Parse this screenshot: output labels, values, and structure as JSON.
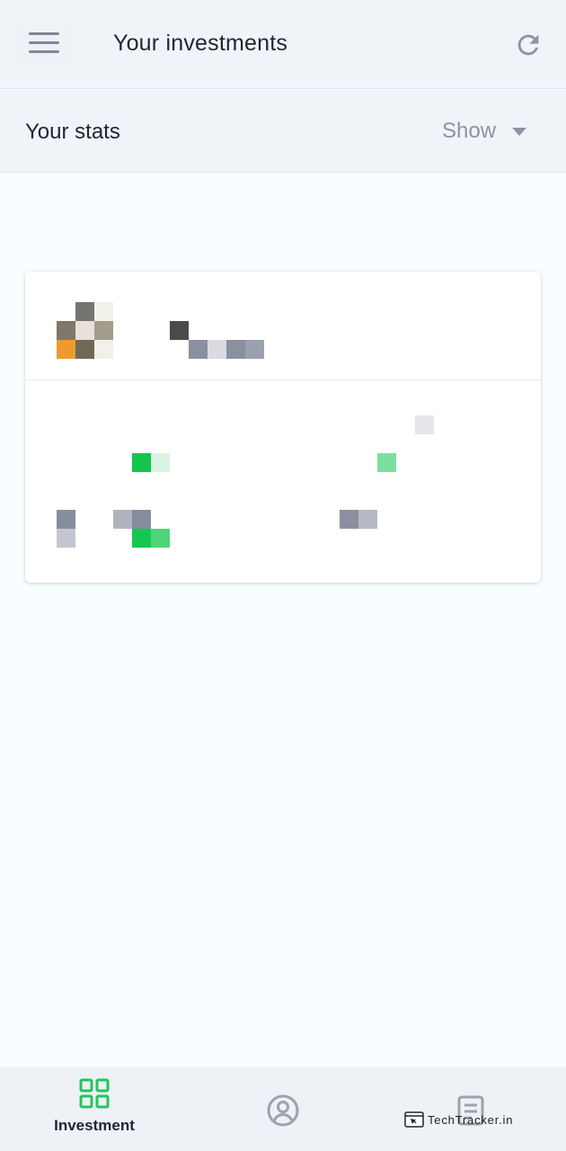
{
  "appbar": {
    "title": "Your investments",
    "menu_icon": "hamburger-menu-icon",
    "refresh_icon": "refresh-icon"
  },
  "stats": {
    "title": "Your stats",
    "dropdown_value": "Show"
  },
  "card": {
    "logo_alt": "pixelated-logo",
    "redacted": true
  },
  "bottom_nav": {
    "items": [
      {
        "label": "Investment",
        "icon": "grid-icon",
        "active": true
      },
      {
        "label": "",
        "icon": "profile-icon",
        "active": false
      },
      {
        "label": "",
        "icon": "report-icon",
        "active": false
      }
    ]
  },
  "watermark": "TechTracker.in",
  "colors": {
    "accent": "#22c55e",
    "icon_gray": "#8c93a2",
    "header_bg": "#f0f3f8",
    "page_bg": "#f8fdff"
  }
}
